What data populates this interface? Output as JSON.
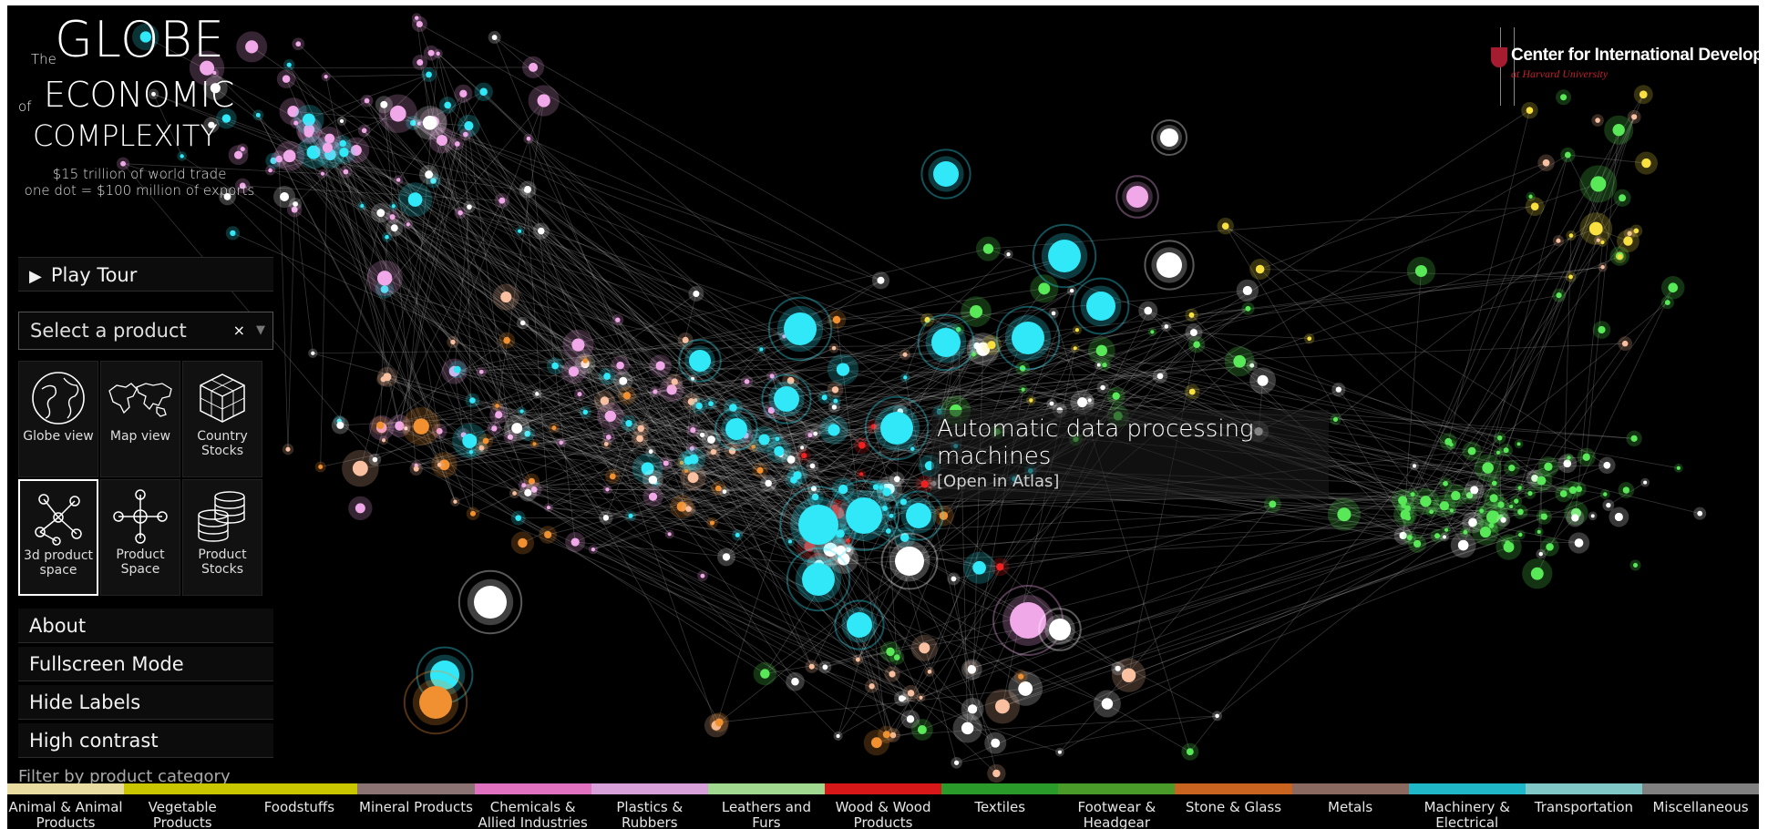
{
  "title": {
    "the": "The",
    "globe": "GLOBE",
    "of": "of",
    "economic": "ECONOMIC",
    "complexity": "COMPLEXITY",
    "subtitle_line1": "$15 trillion of world trade",
    "subtitle_line2": "one dot = $100 million of exports"
  },
  "logo": {
    "name": "Center for International Development",
    "sub": "at Harvard University"
  },
  "sidebar": {
    "play_tour": "Play Tour",
    "play_icon": "play-icon",
    "select_placeholder": "Select a product",
    "select_clear": "×",
    "views": [
      {
        "label": "Globe view",
        "icon": "globe-icon"
      },
      {
        "label": "Map view",
        "icon": "world-map-icon"
      },
      {
        "label": "Country\nStocks",
        "icon": "cube-stack-icon"
      },
      {
        "label": "3d product\nspace",
        "icon": "network-3d-icon",
        "active": true
      },
      {
        "label": "Product\nSpace",
        "icon": "network-icon"
      },
      {
        "label": "Product\nStocks",
        "icon": "coin-stack-icon"
      }
    ],
    "about": "About",
    "fullscreen": "Fullscreen Mode",
    "hide_labels": "Hide Labels",
    "high_contrast": "High contrast"
  },
  "tooltip": {
    "name": "Automatic data processing machines",
    "link": "[Open in Atlas]"
  },
  "filter_label": "Filter by product category",
  "categories": [
    {
      "label": "Animal & Animal\nProducts",
      "color": "#e8dca0"
    },
    {
      "label": "Vegetable\nProducts",
      "color": "#c9c600"
    },
    {
      "label": "Foodstuffs",
      "color": "#c9c600"
    },
    {
      "label": "Mineral Products",
      "color": "#8c7373"
    },
    {
      "label": "Chemicals &\nAllied Industries",
      "color": "#e070c0"
    },
    {
      "label": "Plastics &\nRubbers",
      "color": "#d8a0d8"
    },
    {
      "label": "Leathers and\nFurs",
      "color": "#a0d890"
    },
    {
      "label": "Wood & Wood\nProducts",
      "color": "#d81818"
    },
    {
      "label": "Textiles",
      "color": "#2a9a2a"
    },
    {
      "label": "Footwear &\nHeadgear",
      "color": "#4a9a2a"
    },
    {
      "label": "Stone & Glass",
      "color": "#c86420"
    },
    {
      "label": "Metals",
      "color": "#8a6a60"
    },
    {
      "label": "Machinery &\nElectrical",
      "color": "#20b8c8"
    },
    {
      "label": "Transportation",
      "color": "#80c8c8"
    },
    {
      "label": "Miscellaneous",
      "color": "#808080"
    }
  ],
  "palette": {
    "cyan": "#30e8f8",
    "pink": "#f0a8e8",
    "green": "#58e858",
    "yellow": "#f8e040",
    "orange": "#f09030",
    "red": "#f02020",
    "white": "#ffffff",
    "peach": "#f8c0a0"
  }
}
